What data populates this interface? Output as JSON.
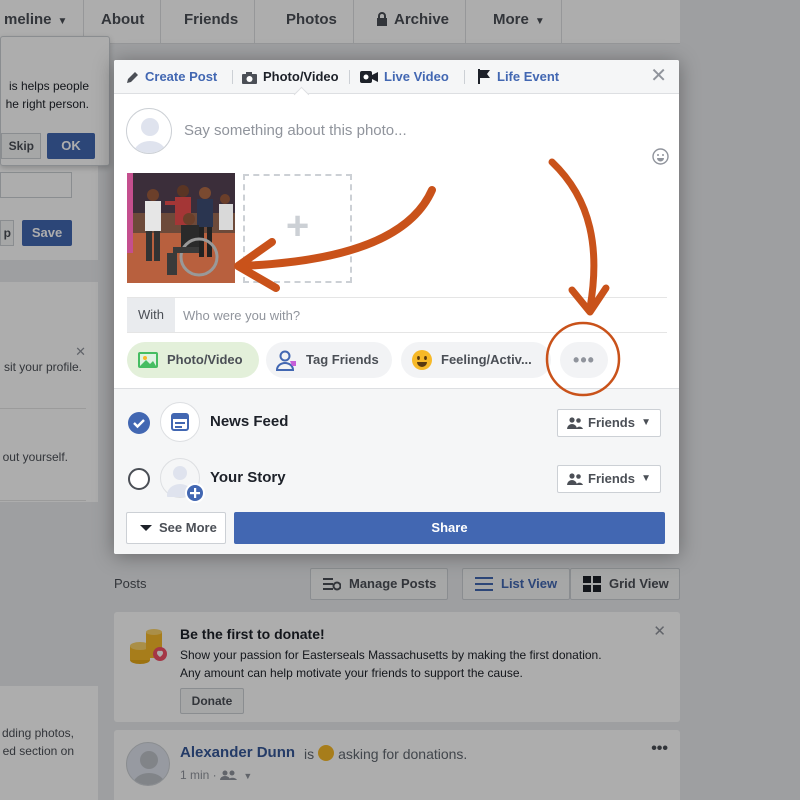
{
  "nav": {
    "tabs": [
      {
        "label": "meline"
      },
      {
        "label": "About"
      },
      {
        "label": "Friends"
      },
      {
        "label": "Photos"
      },
      {
        "label": "Archive"
      },
      {
        "label": "More"
      }
    ]
  },
  "tip": {
    "line1": "is helps people",
    "line2": "he right person.",
    "skip": "Skip",
    "ok": "OK"
  },
  "leftpanel": {
    "button_partial": "p",
    "save": "Save"
  },
  "leftinfo": {
    "line1": "sit your profile.",
    "line2": "out yourself."
  },
  "leftbottom": {
    "line1": "dding photos,",
    "line2": "ed section on"
  },
  "posts_bar": {
    "label": "Posts",
    "manage": "Manage Posts",
    "list_view": "List View",
    "grid_view": "Grid View"
  },
  "donate": {
    "title": "Be the first to donate!",
    "line1": "Show your passion for Easterseals Massachusetts by making the first donation.",
    "line2": "Any amount can help motivate your friends to support the cause.",
    "button": "Donate"
  },
  "feed": {
    "name": "Alexander Dunn",
    "is": "is",
    "rest": "asking for donations.",
    "time": "1 min ·"
  },
  "modal": {
    "tabs": {
      "create_post": "Create Post",
      "photo_video": "Photo/Video",
      "live_video": "Live Video",
      "life_event": "Life Event"
    },
    "composer_placeholder": "Say something about this photo...",
    "add_symbol": "+",
    "with_label": "With",
    "with_placeholder": "Who were you with?",
    "pills": {
      "photo_video": "Photo/Video",
      "tag_friends": "Tag Friends",
      "feeling": "Feeling/Activ...",
      "more": "•••"
    },
    "destinations": [
      {
        "label": "News Feed",
        "audience": "Friends",
        "selected": true
      },
      {
        "label": "Your Story",
        "audience": "Friends",
        "selected": false
      }
    ],
    "see_more": "See More",
    "share": "Share"
  },
  "colors": {
    "brand_blue": "#4267b2",
    "annotation_orange": "#c9521a"
  },
  "icons": {
    "close": "close-icon",
    "camera": "camera-icon",
    "video": "live-video-icon",
    "flag": "flag-icon",
    "smiley": "smiley-icon",
    "friends": "friends-icon"
  }
}
